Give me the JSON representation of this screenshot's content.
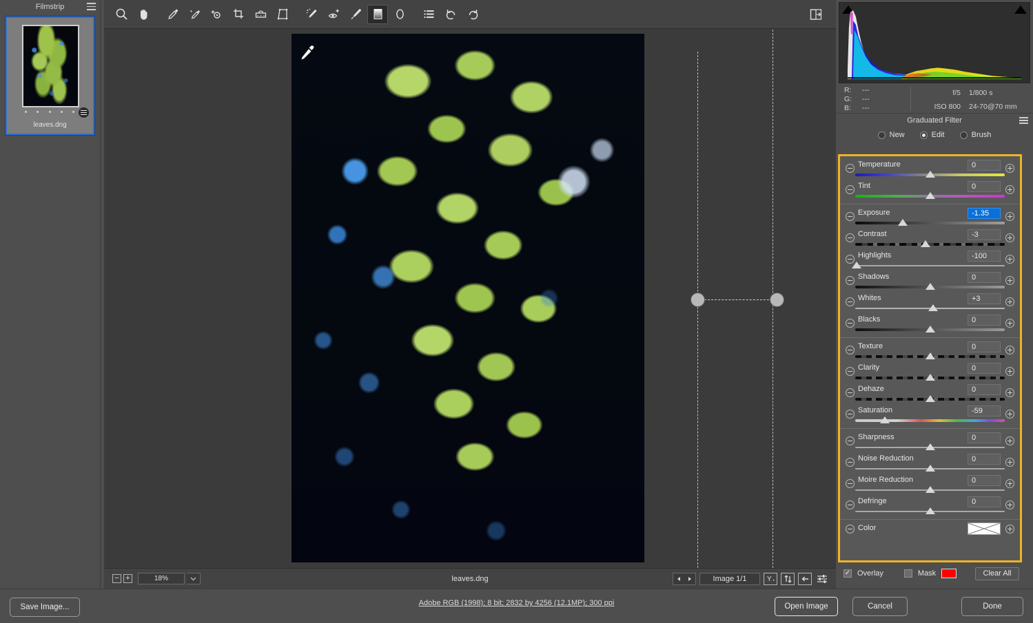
{
  "filmstrip": {
    "title": "Filmstrip",
    "menu_icon": "hamburger-menu-icon",
    "thumbnail": {
      "filename": "leaves.dng",
      "rating_dots": 5,
      "badge_icon": "adjustment-badge-icon"
    }
  },
  "toolbar": {
    "tools": [
      {
        "name": "zoom-tool",
        "icon": "magnifier-icon",
        "selected": false
      },
      {
        "name": "hand-tool",
        "icon": "hand-icon",
        "selected": false
      },
      {
        "name": "white-balance-tool",
        "icon": "eyedropper-icon",
        "selected": false
      },
      {
        "name": "color-sampler-tool",
        "icon": "eyedropper-sparkle-icon",
        "selected": false
      },
      {
        "name": "targeted-adjustment-tool",
        "icon": "target-adjust-icon",
        "selected": false
      },
      {
        "name": "crop-tool",
        "icon": "crop-icon",
        "selected": false
      },
      {
        "name": "straighten-tool",
        "icon": "straighten-icon",
        "selected": false
      },
      {
        "name": "transform-tool",
        "icon": "transform-grid-icon",
        "selected": false
      },
      {
        "name": "spot-removal-tool",
        "icon": "healing-brush-icon",
        "selected": false
      },
      {
        "name": "red-eye-tool",
        "icon": "red-eye-icon",
        "selected": false
      },
      {
        "name": "adjustment-brush-tool",
        "icon": "paintbrush-icon",
        "selected": false
      },
      {
        "name": "graduated-filter-tool",
        "icon": "gradient-square-icon",
        "selected": true
      },
      {
        "name": "radial-filter-tool",
        "icon": "ellipse-icon",
        "selected": false
      },
      {
        "name": "presets-tool",
        "icon": "list-icon",
        "selected": false
      },
      {
        "name": "rotate-left-tool",
        "icon": "rotate-ccw-icon",
        "selected": false
      },
      {
        "name": "rotate-right-tool",
        "icon": "rotate-cw-icon",
        "selected": false
      }
    ],
    "toggle_fullscreen": {
      "name": "toggle-fullscreen-button",
      "icon": "panel-collapse-icon"
    }
  },
  "canvas": {
    "cursor_icon": "eyedropper-cursor",
    "graduated_filter": {
      "pin_start_icon": "grad-pin-handle",
      "pin_end_icon": "grad-pin-handle",
      "guide_line_icon": "dashed-guide-line"
    }
  },
  "bottom_bar": {
    "zoom_out_icon": "minus-icon",
    "zoom_in_icon": "plus-icon",
    "zoom_level": "18%",
    "zoom_dropdown_icon": "chevron-down-icon",
    "filename": "leaves.dng",
    "prev_icon": "left-arrow-icon",
    "next_icon": "right-arrow-icon",
    "image_counter": "Image 1/1",
    "buttons": [
      {
        "name": "before-after-button",
        "icon": "y-split-icon",
        "label": "Y"
      },
      {
        "name": "swap-before-after-button",
        "icon": "swap-arrows-icon"
      },
      {
        "name": "copy-settings-button",
        "icon": "left-arrow-box-icon"
      },
      {
        "name": "preview-preferences-button",
        "icon": "sliders-icon"
      }
    ]
  },
  "histogram": {
    "left_clip_icon": "shadow-clipping-triangle",
    "right_clip_icon": "highlight-clipping-triangle"
  },
  "readout": {
    "rgb": [
      {
        "channel": "R:",
        "value": "---"
      },
      {
        "channel": "G:",
        "value": "---"
      },
      {
        "channel": "B:",
        "value": "---"
      }
    ],
    "exif": {
      "aperture": "f/5",
      "shutter": "1/800 s",
      "iso": "ISO 800",
      "lens": "24-70@70 mm"
    }
  },
  "panel": {
    "title": "Graduated Filter",
    "menu_icon": "panel-menu-icon",
    "modes": [
      {
        "label": "New",
        "selected": false
      },
      {
        "label": "Edit",
        "selected": true
      },
      {
        "label": "Brush",
        "selected": false
      }
    ],
    "groups": [
      {
        "sliders": [
          {
            "label": "Temperature",
            "value": "0",
            "pos": 50,
            "track": "t-temp",
            "active": false
          },
          {
            "label": "Tint",
            "value": "0",
            "pos": 50,
            "track": "t-tint",
            "active": false
          }
        ]
      },
      {
        "sliders": [
          {
            "label": "Exposure",
            "value": "-1.35",
            "pos": 32,
            "track": "t-exp",
            "active": true
          },
          {
            "label": "Contrast",
            "value": "-3",
            "pos": 47,
            "track": "t-contrast",
            "active": false
          },
          {
            "label": "Highlights",
            "value": "-100",
            "pos": 1,
            "track": "t-plain",
            "active": false
          },
          {
            "label": "Shadows",
            "value": "0",
            "pos": 50,
            "track": "t-dark",
            "active": false
          },
          {
            "label": "Whites",
            "value": "+3",
            "pos": 52,
            "track": "t-light",
            "active": false
          },
          {
            "label": "Blacks",
            "value": "0",
            "pos": 50,
            "track": "t-dark",
            "active": false
          }
        ]
      },
      {
        "sliders": [
          {
            "label": "Texture",
            "value": "0",
            "pos": 50,
            "track": "t-tex",
            "active": false
          },
          {
            "label": "Clarity",
            "value": "0",
            "pos": 50,
            "track": "t-tex",
            "active": false
          },
          {
            "label": "Dehaze",
            "value": "0",
            "pos": 50,
            "track": "t-tex",
            "active": false
          },
          {
            "label": "Saturation",
            "value": "-59",
            "pos": 20,
            "track": "t-sat",
            "active": false
          }
        ]
      },
      {
        "sliders": [
          {
            "label": "Sharpness",
            "value": "0",
            "pos": 50,
            "track": "t-plain",
            "active": false
          },
          {
            "label": "Noise Reduction",
            "value": "0",
            "pos": 50,
            "track": "t-plain",
            "active": false
          },
          {
            "label": "Moire Reduction",
            "value": "0",
            "pos": 50,
            "track": "t-plain",
            "active": false
          },
          {
            "label": "Defringe",
            "value": "0",
            "pos": 50,
            "track": "t-plain",
            "active": false
          }
        ]
      }
    ],
    "color_row": {
      "label": "Color",
      "swatch_icon": "no-color-swatch"
    },
    "footer": {
      "overlay_label": "Overlay",
      "overlay_checked": true,
      "mask_label": "Mask",
      "mask_checked": false,
      "mask_color": "#ff0000",
      "clear_all_label": "Clear All"
    },
    "highlight_color": "#f0b323"
  },
  "footer": {
    "save_image": "Save Image...",
    "color_info": "Adobe RGB (1998); 8 bit; 2832 by 4256 (12.1MP); 300 ppi",
    "open_image": "Open Image",
    "cancel": "Cancel",
    "done": "Done"
  }
}
